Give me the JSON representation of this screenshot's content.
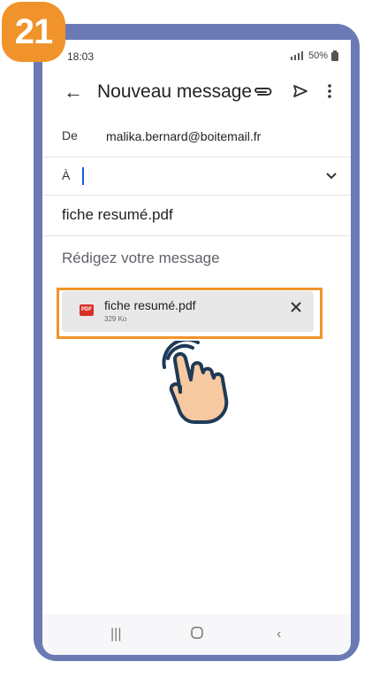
{
  "step": {
    "number": "21",
    "color": "#f0932b"
  },
  "status_bar": {
    "time": "18:03",
    "battery": "50%",
    "signal_icon": "signal-icon",
    "battery_icon": "battery-icon"
  },
  "app_bar": {
    "title": "Nouveau message",
    "back_icon": "arrow-back-icon",
    "actions": [
      "paperclip-icon",
      "send-icon",
      "more-vert-icon"
    ]
  },
  "compose": {
    "from_label": "De",
    "from_value": "malika.bernard@boitemail.fr",
    "to_label": "À",
    "to_value": "",
    "subject": "fiche resumé.pdf",
    "body_placeholder": "Rédigez votre message"
  },
  "attachment": {
    "icon_text": "PDF",
    "name": "fiche resumé.pdf",
    "size": "329 Ko",
    "remove_icon": "close-icon"
  },
  "nav_bar": {
    "buttons": [
      "recents-icon",
      "home-icon",
      "back-icon"
    ]
  },
  "colors": {
    "accent": "#f0932b",
    "phone_frame": "#6b7ab4",
    "cursor": "#1a5bd6",
    "pdf": "#d93025"
  }
}
